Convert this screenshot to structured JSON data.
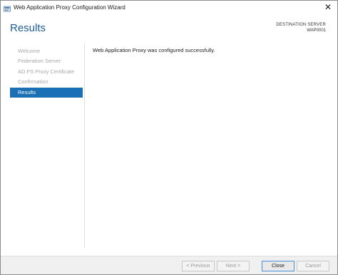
{
  "window": {
    "title": "Web Application Proxy Configuration Wizard",
    "close_glyph": "✕"
  },
  "header": {
    "page_title": "Results",
    "destination_label": "DESTINATION SERVER",
    "destination_value": "WAP0001"
  },
  "sidebar": {
    "items": [
      {
        "label": "Welcome",
        "active": false
      },
      {
        "label": "Federation Server",
        "active": false
      },
      {
        "label": "AD FS Proxy Certificate",
        "active": false
      },
      {
        "label": "Confirmation",
        "active": false
      },
      {
        "label": "Results",
        "active": true
      }
    ]
  },
  "main": {
    "message": "Web Application Proxy was configured successfully."
  },
  "footer": {
    "previous_label": "< Previous",
    "next_label": "Next >",
    "close_label": "Close",
    "cancel_label": "Cancel"
  },
  "colors": {
    "accent": "#1a6fb5",
    "title_blue": "#1f5e96"
  },
  "icons": {
    "app": "server-manager-icon",
    "close": "close-icon"
  }
}
